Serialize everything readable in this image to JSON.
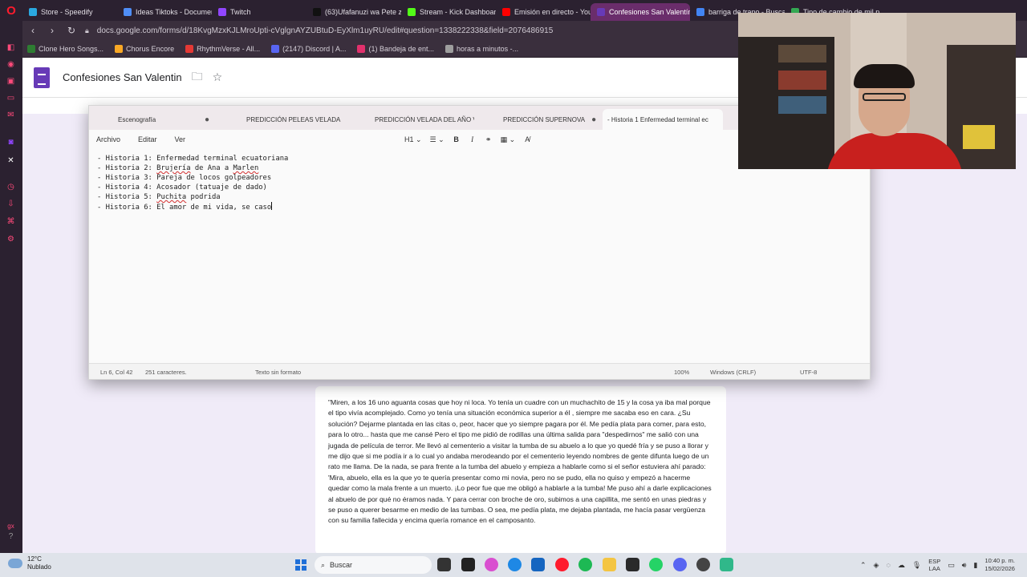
{
  "browser": {
    "tabs": [
      {
        "label": "Store - Speedify",
        "color": "#2aa8e0",
        "active": false
      },
      {
        "label": "Ideas Tiktoks - Document",
        "color": "#4f8ef7",
        "active": false
      },
      {
        "label": "Twitch",
        "color": "#9146ff",
        "active": false
      },
      {
        "label": "(63)Ufafanuzi wa Pete za",
        "color": "#111111",
        "active": false
      },
      {
        "label": "Stream - Kick Dashboard",
        "color": "#53fc18",
        "active": false
      },
      {
        "label": "Emisión en directo - YouT",
        "color": "#ff0000",
        "active": false
      },
      {
        "label": "Confesiones San Valentín",
        "color": "#673ab7",
        "active": true
      },
      {
        "label": "barriga de trapo - Buscar",
        "color": "#4285f4",
        "active": false
      },
      {
        "label": "Tipo de cambio de mil pe",
        "color": "#34a853",
        "active": false
      }
    ],
    "url": "docs.google.com/forms/d/18KvgMzxKJLMroUpti-cVglgnAYZUBtuD-EyXlm1uyRU/edit#question=1338222338&field=2076486915",
    "bookmarks": [
      {
        "label": "Clone Hero Songs...",
        "color": "#2e7d32"
      },
      {
        "label": "Chorus Encore",
        "color": "#f9a825"
      },
      {
        "label": "RhythmVerse - All...",
        "color": "#e53935"
      },
      {
        "label": "(2147) Discord | A...",
        "color": "#5865f2"
      },
      {
        "label": "(1) Bandeja de ent...",
        "color": "#e1306c"
      },
      {
        "label": "horas a minutos -...",
        "color": "#9e9e9e"
      }
    ]
  },
  "forms": {
    "title": "Confesiones San Valentin",
    "paragraph": "\"Miren, a los 16 uno aguanta cosas que hoy ni loca. Yo tenía un cuadre con un muchachito de 15 y la cosa ya iba mal porque el tipo vivía acomplejado. Como yo tenía una situación económica superior a él , siempre me sacaba eso en cara. ¿Su solución? Dejarme plantada en las citas o, peor, hacer que yo siempre pagara por él. Me pedía plata para comer, para esto, para lo otro... hasta que me cansé Pero el tipo me pidió de rodillas una última salida para \"despedirnos\" me salió con una jugada de película de terror. Me llevó al cementerio a visitar la tumba de su abuelo a lo que yo quedé fría y se puso a llorar y me dijo que si me podía ir a lo cual yo andaba merodeando por el cementerio leyendo nombres de gente difunta luego de un rato me llama. De la nada, se para frente a la tumba del abuelo y empieza a hablarle como si el señor estuviera ahí parado: 'Mira, abuelo, ella es la que yo te quería presentar como mi novia, pero no se pudo, ella no quiso y empezó a hacerme quedar como la mala frente a un muerto. ¡Lo peor fue que me obligó a hablarle a la tumba! Me puso ahí a darle explicaciones al abuelo de por qué no éramos nada. Y para cerrar con broche de oro, subimos a una capillita, me sentó en unas piedras y se puso a querer besarme en medio de las tumbas. O sea, me pedía plata, me dejaba plantada, me hacía pasar vergüenza con su familia fallecida y encima quería romance en el camposanto."
  },
  "notepad": {
    "tabs": [
      "Escenografía",
      "PREDICCIÓN PELEAS VELADA",
      "PREDICCIÓN VELADA DEL AÑO V",
      "PREDICCIÓN SUPERNOVA",
      "- Historia 1 Enfermedad terminal ec"
    ],
    "menu": [
      "Archivo",
      "Editar",
      "Ver"
    ],
    "toolbar": {
      "heading": "H1 ⌄",
      "list": "☰ ⌄",
      "bold": "B",
      "italic": "I",
      "link": "⚭",
      "table": "▦ ⌄",
      "clear": "A̸"
    },
    "lines": [
      {
        "prefix": "- Historia 1: ",
        "squiggle": "",
        "text": "Enfermedad terminal ecuatoriana",
        "squiggle2": "",
        "tail": ""
      },
      {
        "prefix": "- Historia 2: ",
        "squiggle": "Brujería",
        "text": " de Ana a ",
        "squiggle2": "Marlen",
        "tail": ""
      },
      {
        "prefix": "- Historia 3: ",
        "squiggle": "",
        "text": "Pareja de locos golpeadores",
        "squiggle2": "",
        "tail": ""
      },
      {
        "prefix": "- Historia 4: ",
        "squiggle": "",
        "text": "Acosador (tatuaje de dado)",
        "squiggle2": "",
        "tail": ""
      },
      {
        "prefix": "- Historia 5: ",
        "squiggle": "Puchita",
        "text": " podrida",
        "squiggle2": "",
        "tail": ""
      },
      {
        "prefix": "- Historia 6: ",
        "squiggle": "",
        "text": "El amor de mi vida, se caso",
        "squiggle2": "",
        "tail": ""
      }
    ],
    "status": {
      "position": "Ln 6, Col 42",
      "chars": "251 caracteres.",
      "format": "Texto sin formato",
      "zoom": "100%",
      "eol": "Windows (CRLF)",
      "encoding": "UTF-8"
    }
  },
  "taskbar": {
    "weather_temp": "12°C",
    "weather_desc": "Nublado",
    "search_placeholder": "Buscar",
    "lang_top": "ESP",
    "lang_bottom": "LAA",
    "time": "10:40 p. m.",
    "date": "15/02/2026"
  }
}
